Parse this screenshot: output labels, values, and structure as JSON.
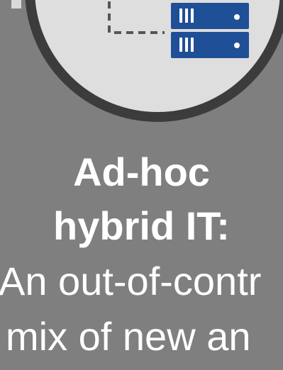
{
  "title": {
    "line1": "Ad-hoc",
    "line2": "hybrid IT:"
  },
  "subtitle": {
    "line1": "An out-of-contr",
    "line2": "mix of new an"
  },
  "icons": {
    "diagram": "hybrid-it-circle-diagram",
    "server": "server-rack-icon",
    "connector": "dashed-connector-line"
  },
  "colors": {
    "background": "#7f7f7f",
    "circle_fill": "#dedede",
    "circle_ring": "#3c3c3c",
    "server_blue": "#1f4f96",
    "text": "#ffffff"
  }
}
